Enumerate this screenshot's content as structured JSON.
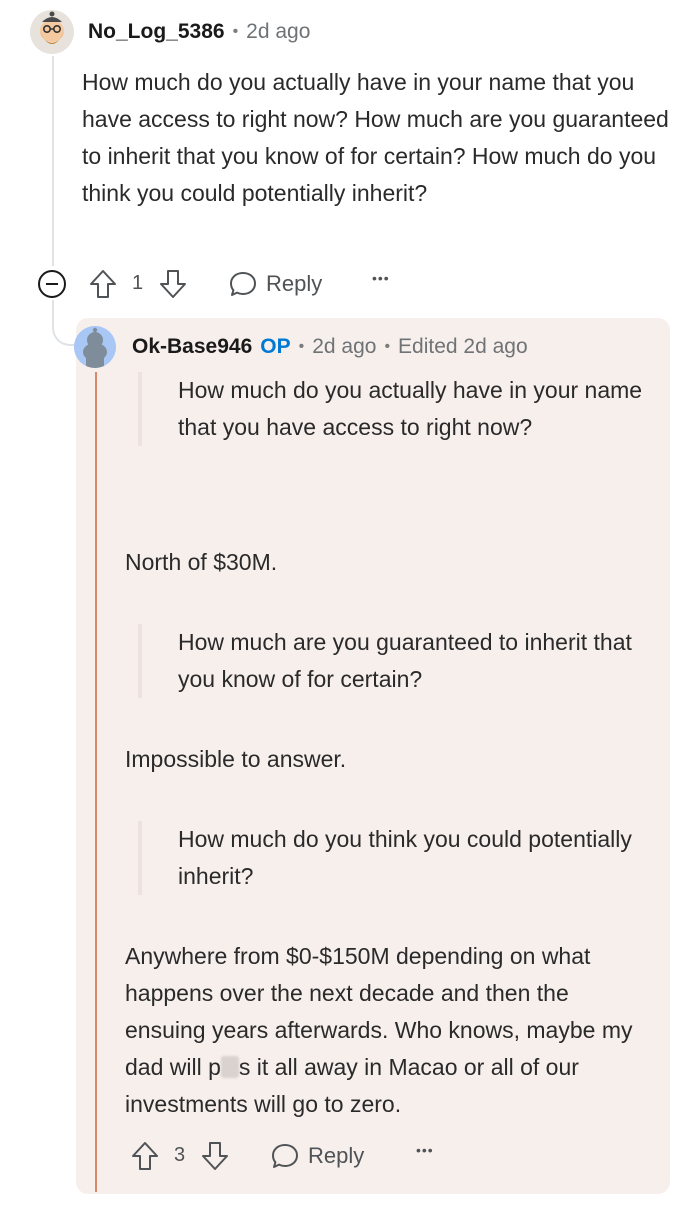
{
  "comment": {
    "username": "No_Log_5386",
    "time": "2d ago",
    "body": "How much do you actually have in your name that you have access to right now? How much are you guaranteed to inherit that you know of for certain? How much do you think you could potentially inherit?",
    "votes": "1",
    "reply_label": "Reply",
    "more_label": "•••",
    "icons": [
      "collapse-icon",
      "upvote-icon",
      "downvote-icon",
      "reply-icon",
      "more-icon"
    ]
  },
  "reply": {
    "username": "Ok-Base946",
    "op_badge": "OP",
    "time": "2d ago",
    "edited": "Edited 2d ago",
    "blocks": {
      "quote1": "How much do you actually have in your name that you have access to right now?",
      "answer1": "North of $30M.",
      "quote2": "How much are you guaranteed to inherit that you know of for certain?",
      "answer2": "Impossible to answer.",
      "quote3": "How much do you think you could potentially inherit?",
      "answer3_part1": "Anywhere from $0-$150M depending on what happens over the next decade and then the ensuing years afterwards. Who knows, maybe my dad will p",
      "answer3_part2": "s it all away in Macao or all of our investments will go to zero."
    },
    "votes": "3",
    "reply_label": "Reply",
    "more_label": "•••"
  },
  "colors": {
    "op_badge": "#0079d3",
    "reply_background": "#f7efec",
    "thread_accent": "#d9896b"
  }
}
